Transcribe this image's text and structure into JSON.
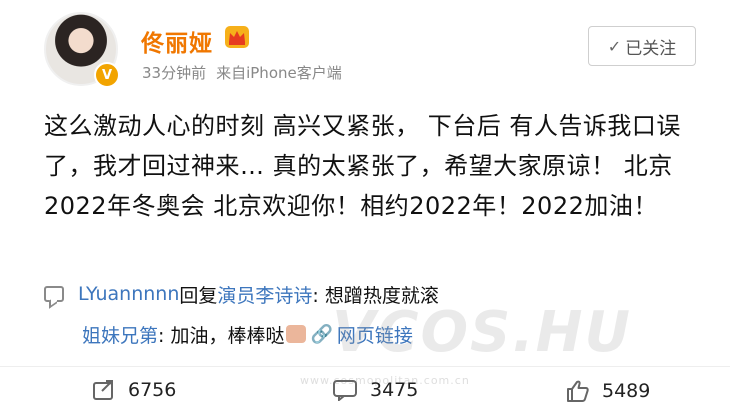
{
  "post": {
    "username": "佟丽娅",
    "time": "33分钟前",
    "source": "来自iPhone客户端",
    "follow_button": "已关注",
    "content": "这么激动人心的时刻 高兴又紧张， 下台后 有人告诉我口误了，我才回过神来… 真的太紧张了，希望大家原谅！ 北京2022年冬奥会 北京欢迎你！相约2022年！2022加油！"
  },
  "comments": [
    {
      "user": "LYuannnnn",
      "reply_word": "回复",
      "reply_to": "演员李诗诗",
      "text": ": 想蹭热度就滚"
    },
    {
      "user": "姐妹兄第",
      "text": ": 加油，棒棒哒",
      "link_text": "网页链接"
    }
  ],
  "watermark": {
    "text": "VCOS.HU",
    "sub": "www.cosmopolitan.com.cn"
  },
  "actions": {
    "repost_count": "6756",
    "comment_count": "3475",
    "like_count": "5489"
  },
  "colors": {
    "username": "#f07700",
    "link": "#3d76bd",
    "badge": "#f2a400"
  },
  "icons": {
    "crown": "crown-icon",
    "verified": "verified-badge-icon",
    "comment": "comment-icon",
    "repost": "repost-icon",
    "like": "thumbs-up-icon",
    "link": "link-icon"
  }
}
